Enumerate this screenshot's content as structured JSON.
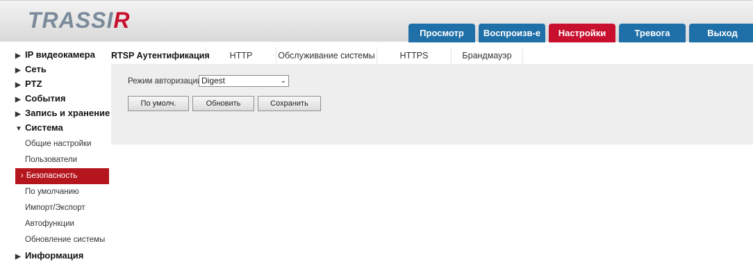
{
  "header": {
    "logo_text_main": "TRASSI",
    "logo_text_r": "R",
    "tabs": [
      {
        "label": "Просмотр",
        "active": false
      },
      {
        "label": "Воспроизв-е",
        "active": false
      },
      {
        "label": "Настройки",
        "active": true
      },
      {
        "label": "Тревога",
        "active": false
      },
      {
        "label": "Выход",
        "active": false
      }
    ]
  },
  "sidebar": {
    "groups_top": [
      {
        "label": "IP видеокамера"
      },
      {
        "label": "Сеть"
      },
      {
        "label": "PTZ"
      },
      {
        "label": "События"
      },
      {
        "label": "Запись и хранение"
      }
    ],
    "system": {
      "label": "Система",
      "expanded": true
    },
    "items": [
      {
        "label": "Общие настройки",
        "active": false
      },
      {
        "label": "Пользователи",
        "active": false
      },
      {
        "label": "Безопасность",
        "active": true
      },
      {
        "label": "По умолчанию",
        "active": false
      },
      {
        "label": "Импорт/Экспорт",
        "active": false
      },
      {
        "label": "Автофункции",
        "active": false
      },
      {
        "label": "Обновление системы",
        "active": false
      }
    ],
    "groups_bottom": [
      {
        "label": "Информация"
      }
    ]
  },
  "subtabs": [
    {
      "label": "RTSP Аутентификация",
      "active": true
    },
    {
      "label": "HTTP",
      "active": false
    },
    {
      "label": "Обслуживание системы",
      "active": false
    },
    {
      "label": "HTTPS",
      "active": false
    },
    {
      "label": "Брандмауэр",
      "active": false
    }
  ],
  "form": {
    "auth_mode_label": "Режим авторизации",
    "auth_mode_value": "Digest"
  },
  "buttons": {
    "default_label": "По умолч.",
    "refresh_label": "Обновить",
    "save_label": "Сохранить"
  },
  "colors": {
    "tab_blue": "#1f6fa8",
    "active_red": "#c8102e",
    "panel_gray": "#eeeeee"
  }
}
